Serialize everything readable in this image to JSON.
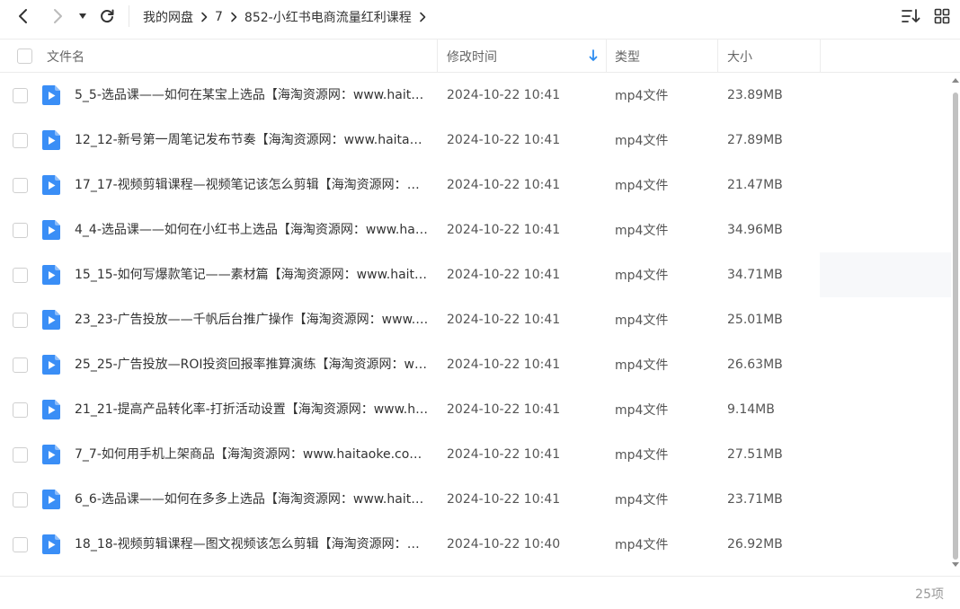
{
  "toolbar": {
    "breadcrumb": [
      "我的网盘",
      "7",
      "852-小红书电商流量红利课程"
    ]
  },
  "columns": {
    "name": "文件名",
    "time": "修改时间",
    "type": "类型",
    "size": "大小"
  },
  "colors": {
    "file_icon": "#3a8ef6",
    "sort_arrow": "#2d8cf0",
    "row_hover": "#f7f8fa"
  },
  "files": [
    {
      "name": "5_5-选品课——如何在某宝上选品【海淘资源网：www.haitaoke...",
      "time": "2024-10-22 10:41",
      "type": "mp4文件",
      "size": "23.89MB"
    },
    {
      "name": "12_12-新号第一周笔记发布节奏【海淘资源网：www.haitaoke...",
      "time": "2024-10-22 10:41",
      "type": "mp4文件",
      "size": "27.89MB"
    },
    {
      "name": "17_17-视频剪辑课程—视频笔记该怎么剪辑【海淘资源网：www...",
      "time": "2024-10-22 10:41",
      "type": "mp4文件",
      "size": "21.47MB"
    },
    {
      "name": "4_4-选品课——如何在小红书上选品【海淘资源网：www.haitao...",
      "time": "2024-10-22 10:41",
      "type": "mp4文件",
      "size": "34.96MB"
    },
    {
      "name": "15_15-如何写爆款笔记——素材篇【海淘资源网：www.haitaok...",
      "time": "2024-10-22 10:41",
      "type": "mp4文件",
      "size": "34.71MB"
    },
    {
      "name": "23_23-广告投放——千帆后台推广操作【海淘资源网：www.hait...",
      "time": "2024-10-22 10:41",
      "type": "mp4文件",
      "size": "25.01MB"
    },
    {
      "name": "25_25-广告投放—ROI投资回报率推算演练【海淘资源网：www...",
      "time": "2024-10-22 10:41",
      "type": "mp4文件",
      "size": "26.63MB"
    },
    {
      "name": "21_21-提高产品转化率-打折活动设置【海淘资源网：www.hait...",
      "time": "2024-10-22 10:41",
      "type": "mp4文件",
      "size": "9.14MB"
    },
    {
      "name": "7_7-如何用手机上架商品【海淘资源网：www.haitaoke.com】",
      "time": "2024-10-22 10:41",
      "type": "mp4文件",
      "size": "27.51MB"
    },
    {
      "name": "6_6-选品课——如何在多多上选品【海淘资源网：www.haitaok...",
      "time": "2024-10-22 10:41",
      "type": "mp4文件",
      "size": "23.71MB"
    },
    {
      "name": "18_18-视频剪辑课程—图文视频该怎么剪辑【海淘资源网：www...",
      "time": "2024-10-22 10:40",
      "type": "mp4文件",
      "size": "26.92MB"
    }
  ],
  "footer": {
    "count": "25项"
  }
}
